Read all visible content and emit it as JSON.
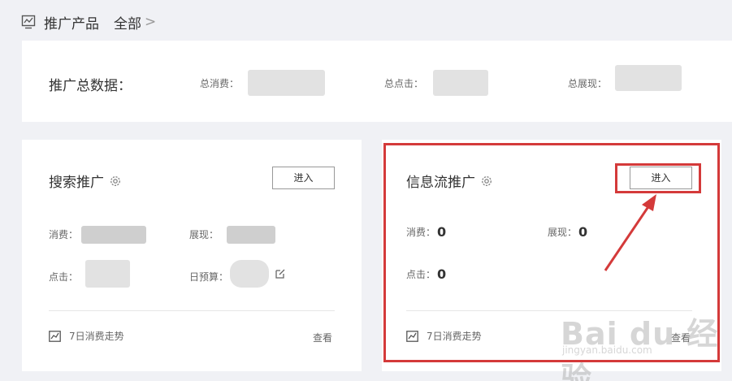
{
  "header": {
    "title": "推广产品",
    "all_link": "全部",
    "chevron": ">"
  },
  "summary": {
    "label": "推广总数据：",
    "total_spend_label": "总消费：",
    "total_clicks_label": "总点击：",
    "total_impressions_label": "总展现："
  },
  "search_card": {
    "title": "搜索推广",
    "enter_label": "进入",
    "spend_label": "消费：",
    "impressions_label": "展现：",
    "clicks_label": "点击：",
    "budget_label": "日预算：",
    "trend_label": "7日消费走势",
    "view_label": "查看"
  },
  "feed_card": {
    "title": "信息流推广",
    "enter_label": "进入",
    "spend_label": "消费：",
    "spend_value": "0",
    "impressions_label": "展现：",
    "impressions_value": "0",
    "clicks_label": "点击：",
    "clicks_value": "0",
    "trend_label": "7日消费走势",
    "view_label": "查看"
  },
  "watermark": {
    "brand": "Bai du 经验",
    "url": "jingyan.baidu.com"
  },
  "colors": {
    "highlight": "#d43a3a",
    "background": "#f0f1f5"
  },
  "icons": [
    "chart-monitor-icon",
    "gear-icon",
    "edit-icon",
    "trend-chart-icon"
  ]
}
